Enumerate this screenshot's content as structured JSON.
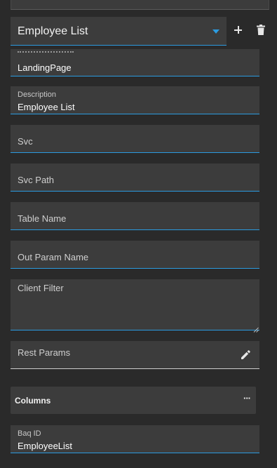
{
  "view_selector": {
    "value": "Employee List"
  },
  "fields": {
    "landing_page": {
      "value": "LandingPage"
    },
    "description": {
      "label": "Description",
      "value": "Employee List"
    },
    "svc": {
      "label": "Svc"
    },
    "svc_path": {
      "label": "Svc Path"
    },
    "table_name": {
      "label": "Table Name"
    },
    "out_param_name": {
      "label": "Out Param Name"
    },
    "client_filter": {
      "label": "Client Filter"
    },
    "rest_params": {
      "label": "Rest Params"
    },
    "baq_id": {
      "label": "Baq ID",
      "value": "EmployeeList"
    }
  },
  "columns_panel": {
    "title": "Columns",
    "more": "···"
  },
  "icons": {
    "add": "plus-icon",
    "delete": "trash-icon",
    "edit": "pencil-icon",
    "dropdown": "chevron-down-icon",
    "more": "more-horizontal-icon"
  },
  "colors": {
    "accent": "#2b9be0",
    "background": "#2a2a2a",
    "field": "#3c3c3c"
  }
}
